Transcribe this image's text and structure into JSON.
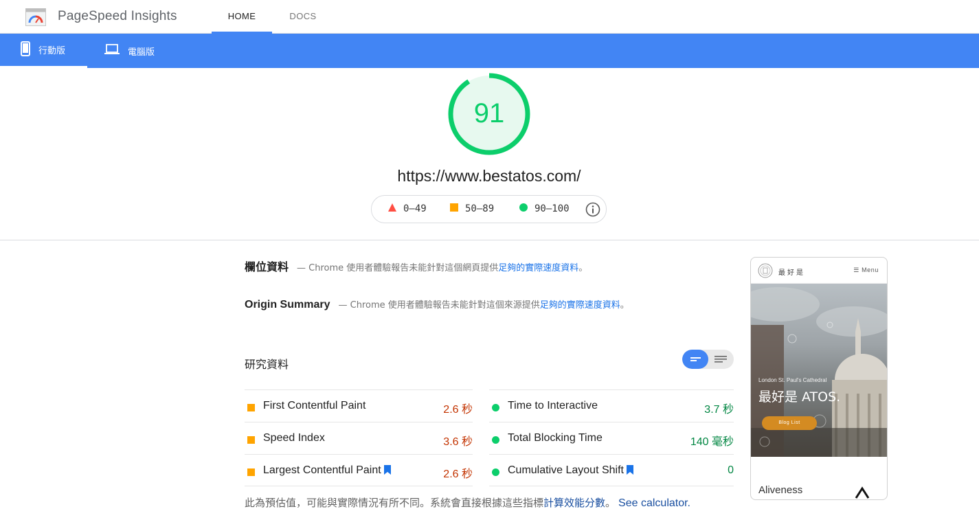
{
  "header": {
    "app_title": "PageSpeed Insights",
    "tabs": [
      {
        "label": "HOME",
        "active": true
      },
      {
        "label": "DOCS",
        "active": false
      }
    ]
  },
  "device_tabs": [
    {
      "label": "行動版",
      "icon": "mobile-phone-icon",
      "active": true
    },
    {
      "label": "電腦版",
      "icon": "laptop-icon",
      "active": false
    }
  ],
  "score": {
    "value": "91",
    "fraction": 0.91,
    "url": "https://www.bestatos.com/"
  },
  "legend": {
    "fail": "0–49",
    "average": "50–89",
    "pass": "90–100"
  },
  "field_data": {
    "title": "欄位資料",
    "desc": "— Chrome 使用者體驗報告未能針對這個網頁提供",
    "link": "足夠的實際速度資料",
    "end": "。"
  },
  "origin_summary": {
    "title": "Origin Summary",
    "desc": "— Chrome 使用者體驗報告未能針對這個來源提供",
    "link": "足夠的實際速度資料",
    "end": "。"
  },
  "lab_data": {
    "title": "研究資料",
    "metrics_left": [
      {
        "label": "First Contentful Paint",
        "value": "2.6 秒",
        "status": "average",
        "bookmark": false
      },
      {
        "label": "Speed Index",
        "value": "3.6 秒",
        "status": "average",
        "bookmark": false
      },
      {
        "label": "Largest Contentful Paint",
        "value": "2.6 秒",
        "status": "average",
        "bookmark": true
      }
    ],
    "metrics_right": [
      {
        "label": "Time to Interactive",
        "value": "3.7 秒",
        "status": "pass",
        "bookmark": false
      },
      {
        "label": "Total Blocking Time",
        "value": "140 毫秒",
        "status": "pass",
        "bookmark": false
      },
      {
        "label": "Cumulative Layout Shift",
        "value": "0",
        "status": "pass",
        "bookmark": true
      }
    ],
    "footnote": {
      "text": "此為預估值，可能與實際情況有所不同。系統會直接根據這些指標",
      "link": "計算效能分數",
      "end": "。",
      "calculator_link": "See calculator."
    }
  },
  "thumbnail": {
    "brand": "最好是",
    "menu": "Menu",
    "caption": "London St. Paul's Cathedral",
    "headline": "最好是 ATOS.",
    "button": "Blog List",
    "footer_text": "Aliveness"
  },
  "colors": {
    "brand_blue": "#4285f4",
    "pass": "#0cce6b",
    "average": "#ffa400",
    "fail": "#ff4e42"
  }
}
